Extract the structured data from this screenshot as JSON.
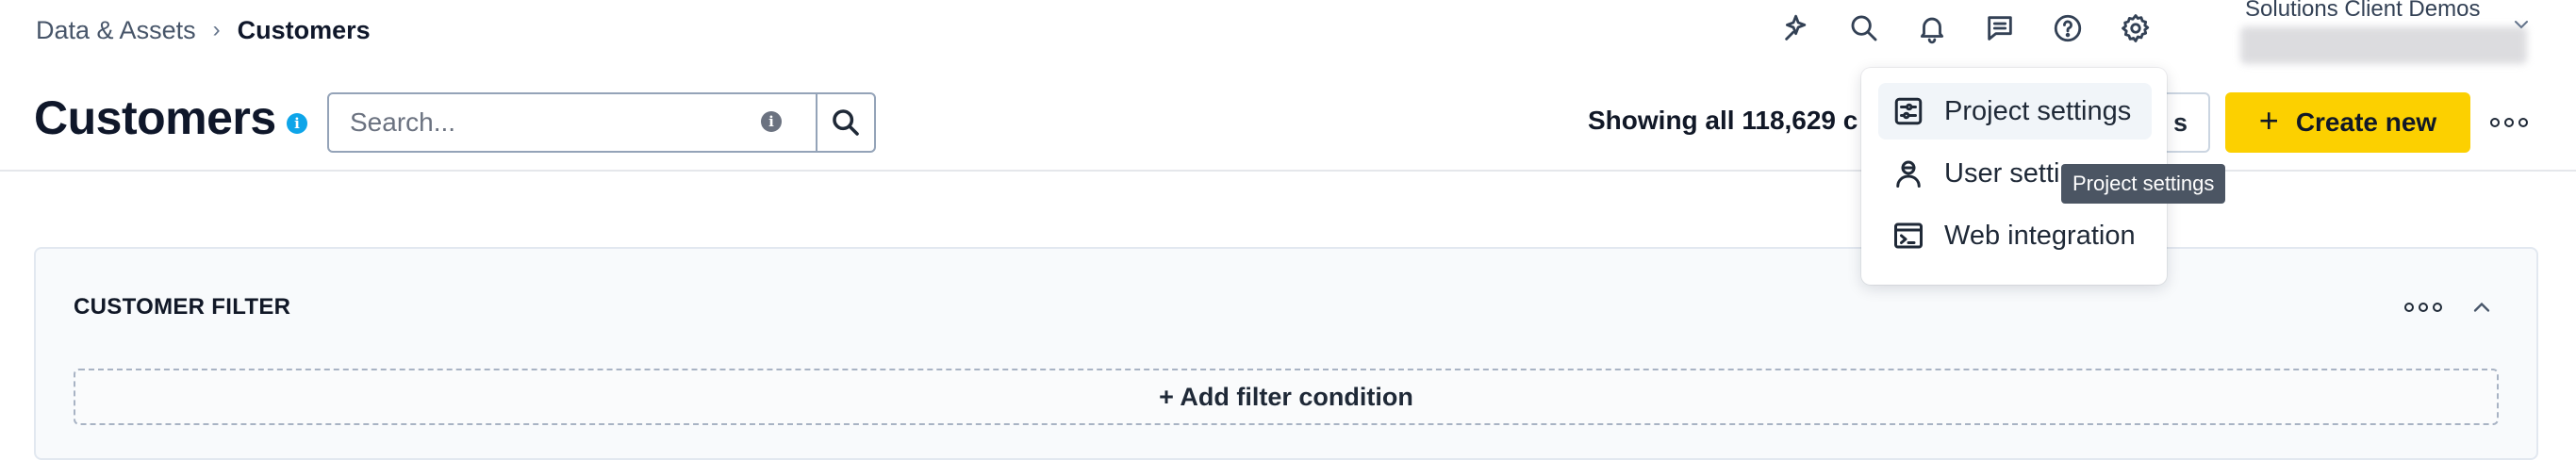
{
  "breadcrumb": {
    "parent": "Data & Assets",
    "separator": "›",
    "current": "Customers"
  },
  "header": {
    "icons": [
      "magic-sparkle-icon",
      "search-icon",
      "bell-icon",
      "chat-icon",
      "help-icon",
      "gear-icon"
    ],
    "org_name": "Solutions Client Demos"
  },
  "page": {
    "title": "Customers",
    "info": "i"
  },
  "search": {
    "placeholder": "Search...",
    "info": "i"
  },
  "toolbar": {
    "showing_text": "Showing all 118,629 c",
    "ghost_button_tail": "s",
    "create_label": "Create new",
    "create_icon": "+",
    "colors": {
      "create_bg": "#fcd000"
    }
  },
  "filter": {
    "title": "CUSTOMER FILTER",
    "add_label": "+ Add filter condition"
  },
  "settings_menu": {
    "items": [
      {
        "label": "Project settings",
        "icon": "sliders-icon"
      },
      {
        "label": "User settings",
        "icon": "user-icon"
      },
      {
        "label": "Web integration",
        "icon": "terminal-icon"
      }
    ],
    "tooltip": "Project settings"
  }
}
